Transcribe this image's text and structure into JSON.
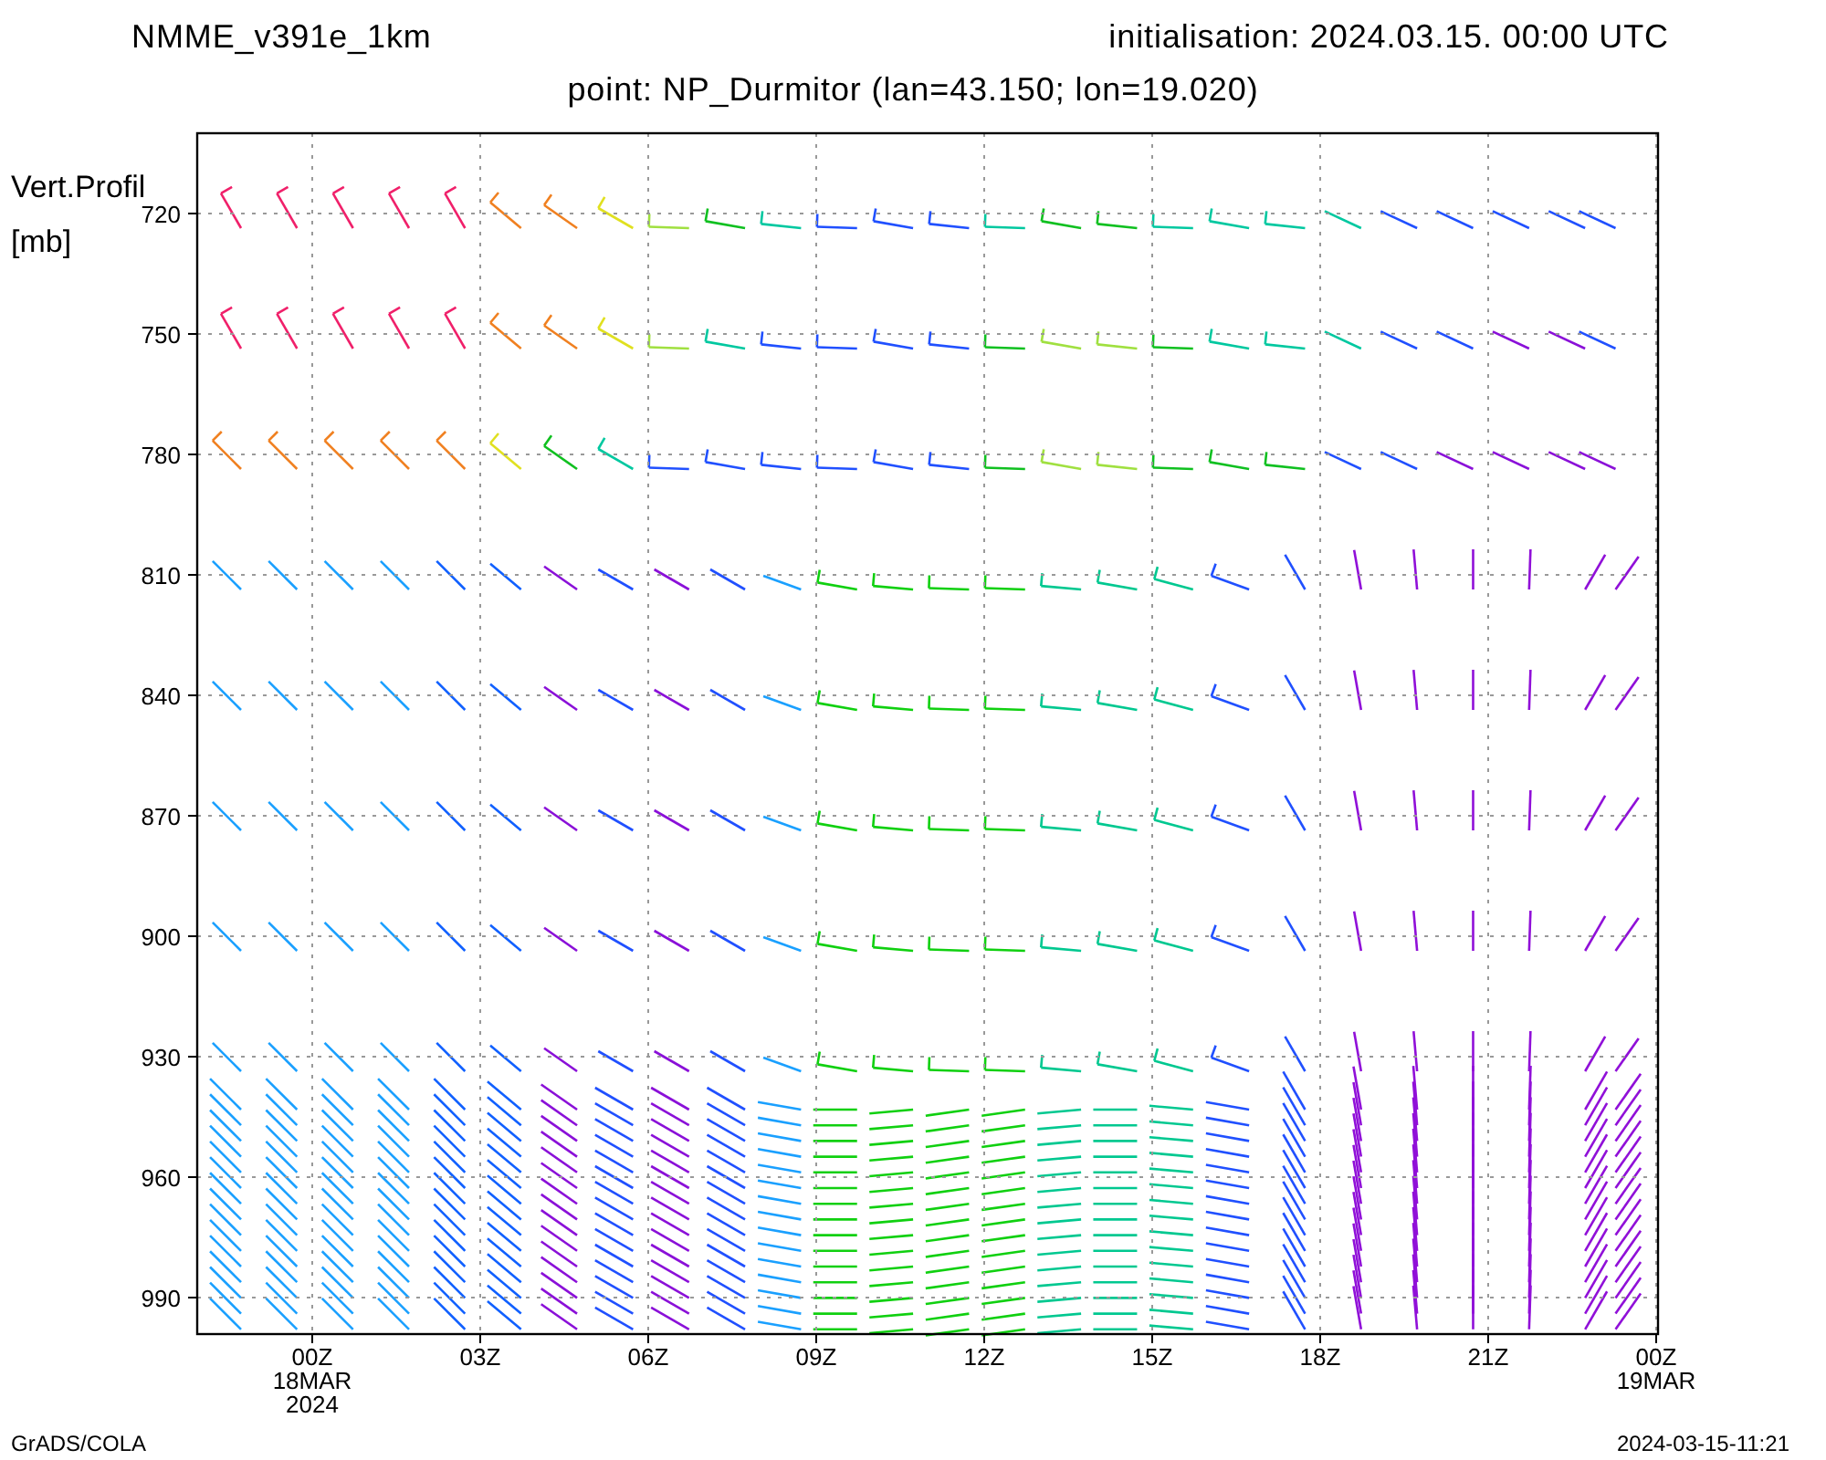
{
  "header": {
    "model": "NMME_v391e_1km",
    "initialisation": "initialisation: 2024.03.15. 00:00 UTC"
  },
  "subtitle": "point: NP_Durmitor (lan=43.150; lon=19.020)",
  "y_axis": {
    "label": "Vert.Profil",
    "unit": "[mb]",
    "ticks": [
      "720",
      "750",
      "780",
      "810",
      "840",
      "870",
      "900",
      "930",
      "960",
      "990"
    ]
  },
  "x_axis": {
    "ticks": [
      {
        "lines": [
          "00Z",
          "18MAR",
          "2024"
        ]
      },
      {
        "lines": [
          "03Z"
        ]
      },
      {
        "lines": [
          "06Z"
        ]
      },
      {
        "lines": [
          "09Z"
        ]
      },
      {
        "lines": [
          "12Z"
        ]
      },
      {
        "lines": [
          "15Z"
        ]
      },
      {
        "lines": [
          "18Z"
        ]
      },
      {
        "lines": [
          "21Z"
        ]
      },
      {
        "lines": [
          "00Z",
          "19MAR"
        ]
      }
    ]
  },
  "footer": {
    "left": "GrADS/COLA",
    "right": "2024-03-15-11:21"
  }
}
